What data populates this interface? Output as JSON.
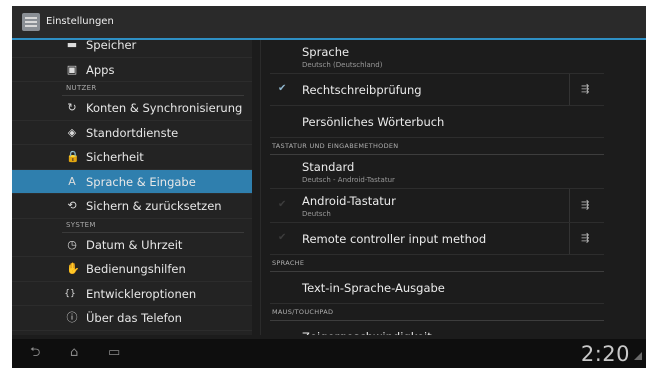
{
  "app_bar": {
    "title": "Einstellungen",
    "icon": "settings-app-icon"
  },
  "left_menu": [
    {
      "kind": "item",
      "label": "Speicher",
      "icon": "storage-icon",
      "glyph": "▬",
      "selected": false
    },
    {
      "kind": "item",
      "label": "Apps",
      "icon": "apps-icon",
      "glyph": "▣",
      "selected": false
    },
    {
      "kind": "header",
      "label": "NUTZER"
    },
    {
      "kind": "item",
      "label": "Konten & Synchronisierung",
      "icon": "sync-icon",
      "glyph": "↻",
      "selected": false
    },
    {
      "kind": "item",
      "label": "Standortdienste",
      "icon": "location-icon",
      "glyph": "◈",
      "selected": false
    },
    {
      "kind": "item",
      "label": "Sicherheit",
      "icon": "lock-icon",
      "glyph": "🔒",
      "selected": false
    },
    {
      "kind": "item",
      "label": "Sprache & Eingabe",
      "icon": "language-icon",
      "glyph": "A",
      "selected": true
    },
    {
      "kind": "item",
      "label": "Sichern & zurücksetzen",
      "icon": "backup-icon",
      "glyph": "⟲",
      "selected": false
    },
    {
      "kind": "header",
      "label": "SYSTEM"
    },
    {
      "kind": "item",
      "label": "Datum & Uhrzeit",
      "icon": "clock-icon",
      "glyph": "◷",
      "selected": false
    },
    {
      "kind": "item",
      "label": "Bedienungshilfen",
      "icon": "accessibility-icon",
      "glyph": "✋",
      "selected": false
    },
    {
      "kind": "item",
      "label": "Entwickleroptionen",
      "icon": "developer-icon",
      "glyph": "{}",
      "selected": false
    },
    {
      "kind": "item",
      "label": "Über das Telefon",
      "icon": "info-icon",
      "glyph": "ⓘ",
      "selected": false
    }
  ],
  "right_prefs": [
    {
      "kind": "pref",
      "title": "Sprache",
      "summary": "Deutsch (Deutschland)",
      "check": "",
      "settings": false
    },
    {
      "kind": "pref",
      "title": "Rechtschreibprüfung",
      "summary": "",
      "check": "on",
      "settings": true
    },
    {
      "kind": "pref",
      "title": "Persönliches Wörterbuch",
      "summary": "",
      "check": "",
      "settings": false
    },
    {
      "kind": "header",
      "label": "TASTATUR UND EINGABEMETHODEN"
    },
    {
      "kind": "pref",
      "title": "Standard",
      "summary": "Deutsch - Android-Tastatur",
      "check": "",
      "settings": false
    },
    {
      "kind": "pref",
      "title": "Android-Tastatur",
      "summary": "Deutsch",
      "check": "dim",
      "settings": true
    },
    {
      "kind": "pref",
      "title": "Remote controller input method",
      "summary": "",
      "check": "dim",
      "settings": true
    },
    {
      "kind": "header",
      "label": "SPRACHE"
    },
    {
      "kind": "pref",
      "title": "Text-in-Sprache-Ausgabe",
      "summary": "",
      "check": "",
      "settings": false
    },
    {
      "kind": "header",
      "label": "MAUS/TOUCHPAD"
    },
    {
      "kind": "pref",
      "title": "Zeigergeschwindigkeit",
      "summary": "",
      "check": "",
      "settings": false
    }
  ],
  "nav_bar": {
    "back_icon": "back-icon",
    "home_icon": "home-icon",
    "recents_icon": "recent-apps-icon",
    "clock": "2:20",
    "signal_icon": "signal-icon"
  },
  "colors": {
    "accent": "#2e8fc4",
    "selected_bg": "#2f7fae",
    "background": "#1c1c1c"
  }
}
